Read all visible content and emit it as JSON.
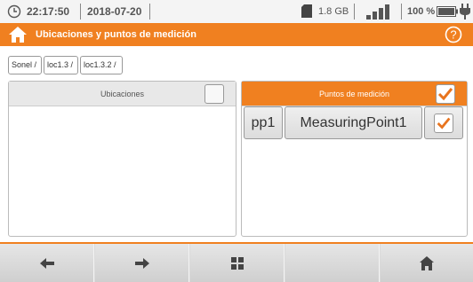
{
  "status": {
    "time": "22:17:50",
    "date": "2018-07-20",
    "memory": "1.8 GB",
    "battery_percent": "100 %"
  },
  "header": {
    "title": "Ubicaciones y puntos de medición"
  },
  "breadcrumb": [
    "Sonel /",
    "loc1.3 /",
    "loc1.3.2 /"
  ],
  "left_panel": {
    "title": "Ubicaciones",
    "select_all_checked": false
  },
  "right_panel": {
    "title": "Puntos de medición",
    "select_all_checked": true,
    "items": [
      {
        "id": "pp1",
        "name": "MeasuringPoint1",
        "checked": true
      }
    ]
  },
  "bottom_nav": [
    "arrow-left-icon",
    "arrow-right-icon",
    "grid-icon",
    "",
    "home-icon"
  ],
  "colors": {
    "accent": "#f08020",
    "check": "#e8741e"
  }
}
